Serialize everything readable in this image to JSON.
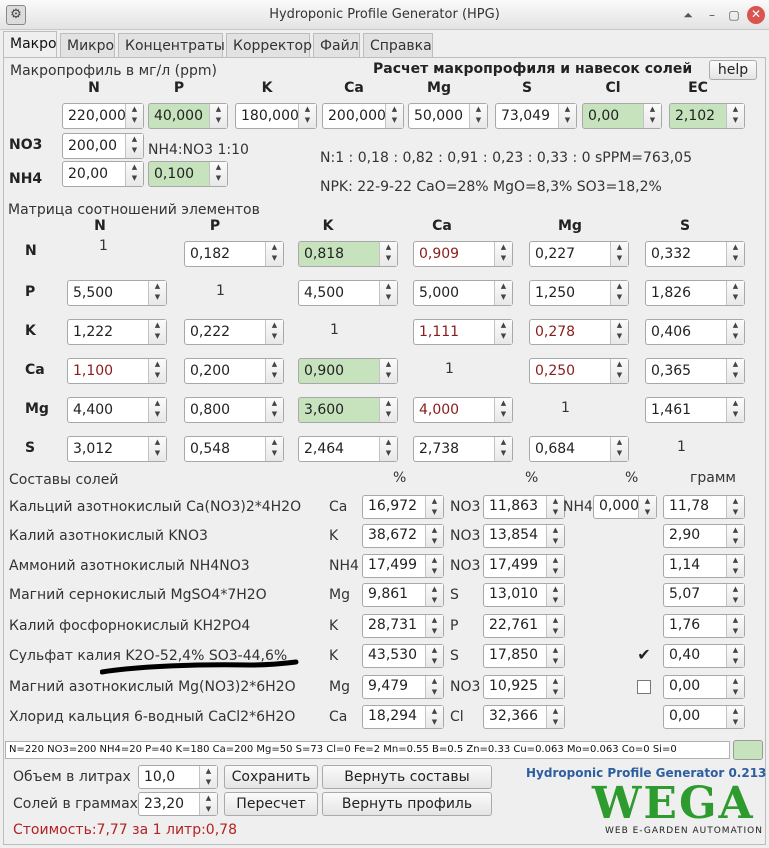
{
  "window": {
    "title": "Hydroponic Profile Generator (HPG)",
    "icon": "app-icon",
    "buttons": [
      "up-icon",
      "minimize-icon",
      "maximize-icon",
      "close-icon"
    ]
  },
  "tabs": [
    "Макро",
    "Микро",
    "Концентраты",
    "Корректор",
    "Файл",
    "Справка"
  ],
  "macro": {
    "profile_label": "Макропрофиль в мг/л (ppm)",
    "calc_title": "Расчет макропрофиля и навесок солей",
    "help_label": "help",
    "headers": [
      "N",
      "P",
      "K",
      "Ca",
      "Mg",
      "S",
      "Cl",
      "EC"
    ],
    "values": [
      "220,000",
      "40,000",
      "180,000",
      "200,000",
      "50,000",
      "73,049",
      "0,00",
      "2,102"
    ],
    "no3_label": "NO3",
    "no3_value": "200,00",
    "nh4_label": "NH4",
    "nh4_value": "20,00",
    "ratio_label": "NH4:NO3 1:10",
    "ratio_value": "0,100",
    "n_ratio_text": "N:1 : 0,18 : 0,82 : 0,91 : 0,23 : 0,33 : 0 sPPM=763,05",
    "npk_text": "NPK: 22-9-22 CaO=28% MgO=8,3% SO3=18,2%"
  },
  "matrix": {
    "title": "Матрица соотношений элементов",
    "col_headers": [
      "N",
      "P",
      "K",
      "Ca",
      "Mg",
      "S"
    ],
    "rows": [
      {
        "label": "N",
        "cells": [
          "1",
          "0,182",
          "0,818",
          "0,909",
          "0,227",
          "0,332"
        ]
      },
      {
        "label": "P",
        "cells": [
          "5,500",
          "1",
          "4,500",
          "5,000",
          "1,250",
          "1,826"
        ]
      },
      {
        "label": "K",
        "cells": [
          "1,222",
          "0,222",
          "1",
          "1,111",
          "0,278",
          "0,406"
        ]
      },
      {
        "label": "Ca",
        "cells": [
          "1,100",
          "0,200",
          "0,900",
          "1",
          "0,250",
          "0,365"
        ]
      },
      {
        "label": "Mg",
        "cells": [
          "4,400",
          "0,800",
          "3,600",
          "4,000",
          "1",
          "1,461"
        ]
      },
      {
        "label": "S",
        "cells": [
          "3,012",
          "0,548",
          "2,464",
          "2,738",
          "0,684",
          "1"
        ]
      }
    ]
  },
  "salts": {
    "title": "Составы солей",
    "pct_header": "%",
    "gram_header": "грамм",
    "rows": [
      {
        "name": "Кальций азотнокислый Ca(NO3)2*4H2O",
        "el1": "Ca",
        "v1": "16,972",
        "el2": "NO3",
        "v2": "11,863",
        "el3": "NH4",
        "v3": "0,000",
        "grams": "11,78",
        "checkbox": null
      },
      {
        "name": "Калий азотнокислый KNO3",
        "el1": "K",
        "v1": "38,672",
        "el2": "NO3",
        "v2": "13,854",
        "grams": "2,90",
        "checkbox": null
      },
      {
        "name": "Аммоний азотнокислый NH4NO3",
        "el1": "NH4",
        "v1": "17,499",
        "el2": "NO3",
        "v2": "17,499",
        "grams": "1,14",
        "checkbox": null
      },
      {
        "name": "Магний сернокислый MgSO4*7H2O",
        "el1": "Mg",
        "v1": "9,861",
        "el2": "S",
        "v2": "13,010",
        "grams": "5,07",
        "checkbox": null
      },
      {
        "name": "Калий фосфорнокислый KH2PO4",
        "el1": "K",
        "v1": "28,731",
        "el2": "P",
        "v2": "22,761",
        "grams": "1,76",
        "checkbox": null
      },
      {
        "name": "Сульфат калия K2O-52,4% SO3-44,6%",
        "el1": "K",
        "v1": "43,530",
        "el2": "S",
        "v2": "17,850",
        "grams": "0,40",
        "checkbox": "✔"
      },
      {
        "name": "Магний азотнокислый Mg(NO3)2*6H2O",
        "el1": "Mg",
        "v1": "9,479",
        "el2": "NO3",
        "v2": "10,925",
        "grams": "0,00",
        "checkbox": ""
      },
      {
        "name": "Хлорид кальция 6-водный CaCl2*6H2O",
        "el1": "Ca",
        "v1": "18,294",
        "el2": "Cl",
        "v2": "32,366",
        "grams": "0,00",
        "checkbox": null
      }
    ]
  },
  "status": "N=220 NO3=200 NH4=20 P=40 K=180 Ca=200 Mg=50 S=73 Cl=0 Fe=2 Mn=0.55 B=0.5 Zn=0.33 Cu=0.063 Mo=0.063 Co=0 Si=0",
  "bottom": {
    "volume_label": "Объем в литрах",
    "volume_value": "10,0",
    "salts_label": "Солей в граммах:",
    "salts_value": "23,20",
    "save": "Сохранить",
    "restore_compositions": "Вернуть составы",
    "recalc": "Пересчет",
    "restore_profile": "Вернуть профиль",
    "cost": "Стоимость:7,77 за 1 литр:0,78",
    "version": "Hydroponic Profile Generator 0.213",
    "logo": "WEGA",
    "logo_sub": "WEB E-GARDEN AUTOMATION"
  },
  "colors": {
    "green_field": "#c6e3bd",
    "red_text": "#8a1c1c",
    "cost_text": "#b22222",
    "version_text": "#2c5ea0",
    "logo_green": "#2e9b2e"
  }
}
